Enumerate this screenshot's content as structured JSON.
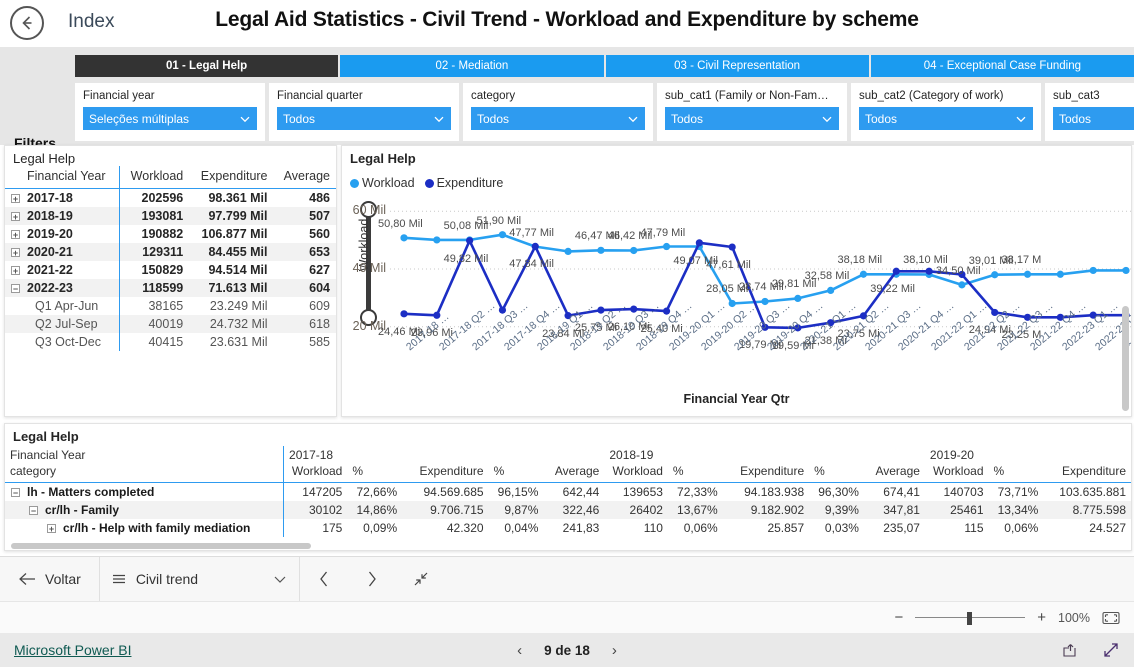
{
  "header": {
    "back_icon": "back-arrow-icon",
    "index_label": "Index",
    "title": "Legal Aid Statistics - Civil Trend - Workload and Expenditure by scheme"
  },
  "filters": {
    "word": "Filters",
    "tabs": [
      {
        "label": "01 - Legal Help",
        "active": true
      },
      {
        "label": "02 - Mediation",
        "active": false
      },
      {
        "label": "03 - Civil Representation",
        "active": false
      },
      {
        "label": "04 - Exceptional Case Funding",
        "active": false
      }
    ],
    "slicers": [
      {
        "label": "Financial year",
        "value": "Seleções múltiplas"
      },
      {
        "label": "Financial quarter",
        "value": "Todos"
      },
      {
        "label": "category",
        "value": "Todos"
      },
      {
        "label": "sub_cat1 (Family or Non-Fam…",
        "value": "Todos"
      },
      {
        "label": "sub_cat2 (Category of work)",
        "value": "Todos"
      },
      {
        "label": "sub_cat3",
        "value": "Todos"
      }
    ]
  },
  "left_table": {
    "title": "Legal Help",
    "columns": [
      "Financial Year",
      "Workload",
      "Expenditure",
      "Average"
    ],
    "rows": [
      {
        "level": 1,
        "expander": "+",
        "label": "2017-18",
        "workload": "202596",
        "expenditure": "98.361 Mil",
        "average": "486"
      },
      {
        "level": 1,
        "expander": "+",
        "label": "2018-19",
        "workload": "193081",
        "expenditure": "97.799 Mil",
        "average": "507"
      },
      {
        "level": 1,
        "expander": "+",
        "label": "2019-20",
        "workload": "190882",
        "expenditure": "106.877 Mil",
        "average": "560"
      },
      {
        "level": 1,
        "expander": "+",
        "label": "2020-21",
        "workload": "129311",
        "expenditure": "84.455 Mil",
        "average": "653"
      },
      {
        "level": 1,
        "expander": "+",
        "label": "2021-22",
        "workload": "150829",
        "expenditure": "94.514 Mil",
        "average": "627"
      },
      {
        "level": 1,
        "expander": "−",
        "label": "2022-23",
        "workload": "118599",
        "expenditure": "71.613 Mil",
        "average": "604"
      },
      {
        "level": 2,
        "expander": "",
        "label": "Q1 Apr-Jun",
        "workload": "38165",
        "expenditure": "23.249 Mil",
        "average": "609"
      },
      {
        "level": 2,
        "expander": "",
        "label": "Q2 Jul-Sep",
        "workload": "40019",
        "expenditure": "24.732 Mil",
        "average": "618"
      },
      {
        "level": 2,
        "expander": "",
        "label": "Q3 Oct-Dec",
        "workload": "40415",
        "expenditure": "23.631 Mil",
        "average": "585"
      }
    ]
  },
  "chart_card": {
    "title": "Legal Help",
    "legend": [
      {
        "name": "Workload",
        "color": "#27a0f0"
      },
      {
        "name": "Expenditure",
        "color": "#1c2ec4"
      }
    ]
  },
  "chart_data": {
    "type": "line",
    "title": "Legal Help",
    "xlabel": "Financial Year Qtr",
    "ylabel": "Workload",
    "ylim": [
      14,
      66
    ],
    "yticks": [
      20,
      40,
      60
    ],
    "ytick_labels": [
      "20 Mil",
      "40 Mil",
      "60 Mil"
    ],
    "grid": true,
    "legend_position": "top-left",
    "x": [
      "2017-18 …",
      "2017-18 Q2 …",
      "2017-18 Q3 …",
      "2017-18 Q4 …",
      "2018-19 Q1 …",
      "2018-19 Q2 …",
      "2018-19 Q3 …",
      "2018-19 Q4 …",
      "2019-20 Q1 …",
      "2019-20 Q2 …",
      "2019-20 Q3 …",
      "2019-20 Q4 …",
      "2020-21 Q1 …",
      "2020-21 Q2 …",
      "2020-21 Q3 …",
      "2020-21 Q4 …",
      "2021-22 Q1 …",
      "2021-22 Q2 …",
      "2021-22 Q3 …",
      "2021-22 Q4 …",
      "2022-23 Q1 …",
      "2022-23 Q2 …",
      "2022-23 …"
    ],
    "series": [
      {
        "name": "Workload",
        "color": "#27a0f0",
        "values": [
          50.8,
          50.08,
          50.08,
          51.9,
          47.77,
          46.1,
          46.47,
          46.42,
          47.79,
          47.79,
          28.05,
          28.74,
          29.81,
          32.58,
          38.18,
          38.18,
          38.1,
          34.5,
          38.01,
          38.17,
          38.17,
          39.5,
          39.5
        ],
        "labels": [
          "50,80 Mil",
          "",
          "50,08 Mil",
          "51,90 Mil",
          "47,77 Mil",
          "",
          "46,47 Mil",
          "46,42 Mil",
          "47,79 Mil",
          "",
          "28,05 Mi",
          "28,74 Mil",
          "29,81 Mil",
          "32,58 Mil",
          "38,18 Mil",
          "",
          "38,10 Mil",
          "34,50 Mil",
          "39,01 Mil",
          "38,17 M",
          "",
          "",
          ""
        ]
      },
      {
        "name": "Expenditure",
        "color": "#1c2ec4",
        "values": [
          24.46,
          23.96,
          49.82,
          25.75,
          47.84,
          23.84,
          25.75,
          26.1,
          25.4,
          49.07,
          47.61,
          19.79,
          19.59,
          21.38,
          23.75,
          39.22,
          39.22,
          38.1,
          24.94,
          23.25,
          23.25,
          24.0,
          24.0
        ],
        "labels": [
          "24,46 Mi",
          "23,96 Mi",
          "49,82 Mil",
          "",
          "47,84 Mil",
          "23,84 Mi",
          "25,75 Mi",
          "26,10 Mi",
          "25,40 Mi",
          "49,07 Mil",
          "47,61 Mil",
          "19,79 Mi",
          "19,59 Mi",
          "21,38 Mi",
          "23,75 Mi",
          "39,22 Mil",
          "",
          "",
          "24,94 Mi",
          "23,25 M",
          "",
          "",
          ""
        ]
      }
    ]
  },
  "bottom_table": {
    "title": "Legal Help",
    "row_header_1": "Financial Year",
    "row_header_2": "category",
    "year_groups": [
      {
        "year": "2017-18",
        "measures": [
          "Workload",
          "%",
          "Expenditure",
          "%",
          "Average"
        ]
      },
      {
        "year": "2018-19",
        "measures": [
          "Workload",
          "%",
          "Expenditure",
          "%",
          "Average"
        ]
      },
      {
        "year": "2019-20",
        "measures": [
          "Workload",
          "%",
          "Expenditure"
        ]
      }
    ],
    "rows": [
      {
        "level": 1,
        "expander": "−",
        "label": "lh - Matters completed",
        "cells": [
          "147205",
          "72,66%",
          "94.569.685",
          "96,15%",
          "642,44",
          "139653",
          "72,33%",
          "94.183.938",
          "96,30%",
          "674,41",
          "140703",
          "73,71%",
          "103.635.881"
        ]
      },
      {
        "level": 2,
        "expander": "−",
        "label": "cr/lh - Family",
        "cells": [
          "30102",
          "14,86%",
          "9.706.715",
          "9,87%",
          "322,46",
          "26402",
          "13,67%",
          "9.182.902",
          "9,39%",
          "347,81",
          "25461",
          "13,34%",
          "8.775.598"
        ]
      },
      {
        "level": 3,
        "expander": "+",
        "label": "cr/lh - Help with family mediation",
        "cells": [
          "175",
          "0,09%",
          "42.320",
          "0,04%",
          "241,83",
          "110",
          "0,06%",
          "25.857",
          "0,03%",
          "235,07",
          "115",
          "0,06%",
          "24.527"
        ]
      }
    ]
  },
  "bottom_bar": {
    "back_label": "Voltar",
    "page_name": "Civil trend",
    "prev_icon": "chevron-left-icon",
    "next_icon": "chevron-right-icon",
    "fit_icon": "fit-to-page-icon"
  },
  "zoom_bar": {
    "minus": "−",
    "plus": "+",
    "level": "100%",
    "fullscreen_icon": "fullscreen-icon"
  },
  "footer": {
    "brand": "Microsoft Power BI",
    "pager_prev": "‹",
    "pager_text": "9 de 18",
    "pager_next": "›",
    "share_icon": "share-icon",
    "expand_icon": "expand-icon"
  },
  "colors": {
    "accent_blue": "#2e9bf0",
    "active_tab": "#333333",
    "workload": "#27a0f0",
    "expenditure": "#1c2ec4",
    "band_bg": "#e6e6e6"
  }
}
